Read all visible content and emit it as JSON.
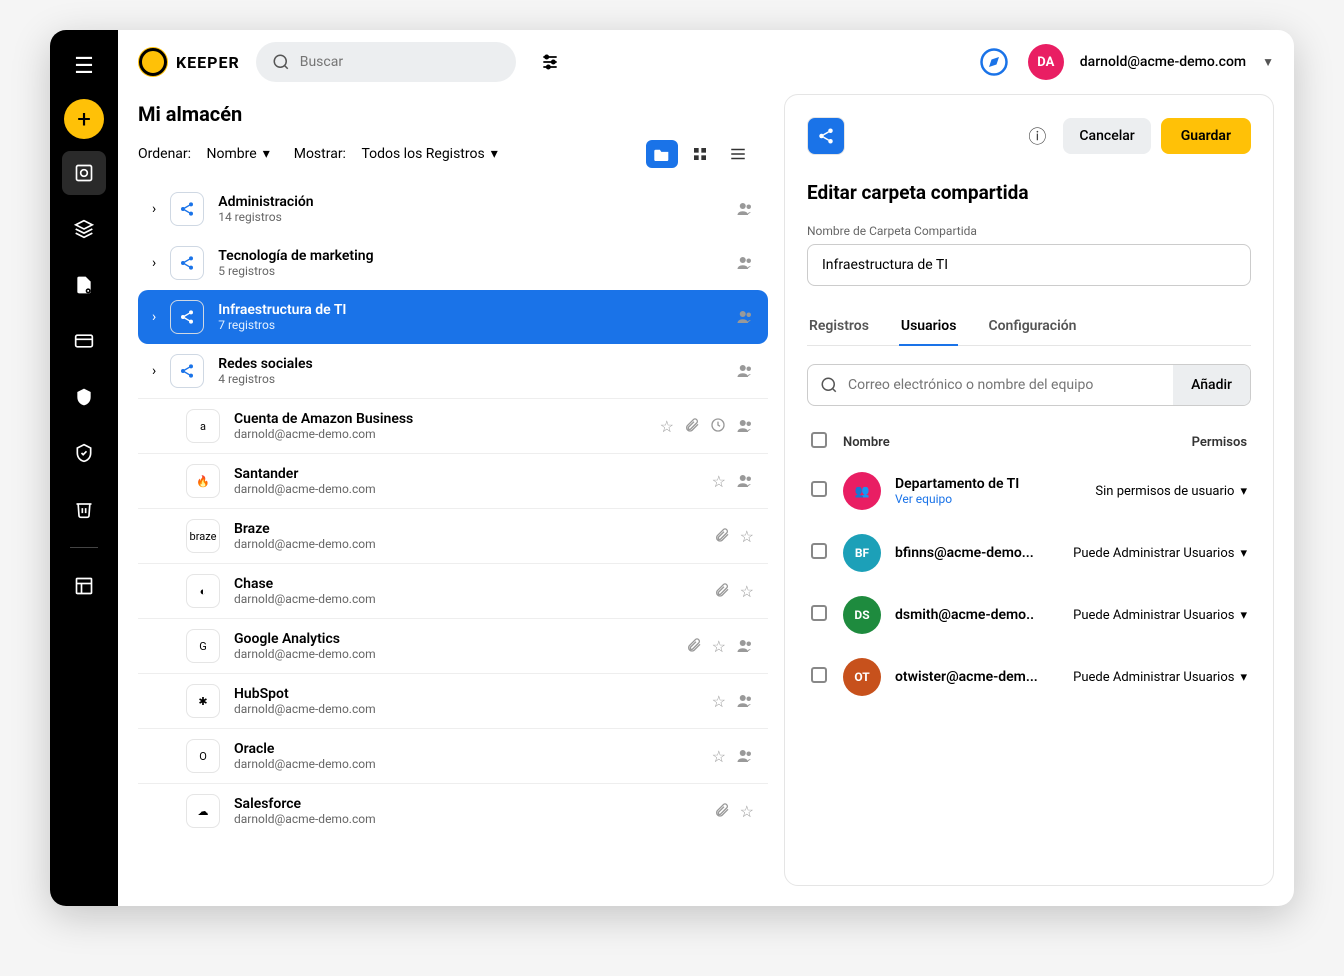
{
  "brand": "KEEPER",
  "search": {
    "placeholder": "Buscar"
  },
  "user": {
    "initials": "DA",
    "email": "darnold@acme-demo.com"
  },
  "vault": {
    "title": "Mi almacén",
    "sort_label": "Ordenar:",
    "sort_value": "Nombre",
    "show_label": "Mostrar:",
    "show_value": "Todos los Registros"
  },
  "folders": [
    {
      "name": "Administración",
      "count": "14 registros",
      "selected": false
    },
    {
      "name": "Tecnología de marketing",
      "count": "5 registros",
      "selected": false
    },
    {
      "name": "Infraestructura de TI",
      "count": "7 registros",
      "selected": true
    },
    {
      "name": "Redes sociales",
      "count": "4 registros",
      "selected": false
    }
  ],
  "records": [
    {
      "name": "Cuenta de Amazon Business",
      "sub": "darnold@acme-demo.com",
      "icon": "a",
      "actions": [
        "star",
        "clip",
        "time",
        "share"
      ]
    },
    {
      "name": "Santander",
      "sub": "darnold@acme-demo.com",
      "icon": "🔥",
      "actions": [
        "star",
        "share"
      ]
    },
    {
      "name": "Braze",
      "sub": "darnold@acme-demo.com",
      "icon": "braze",
      "actions": [
        "clip",
        "star"
      ]
    },
    {
      "name": "Chase",
      "sub": "darnold@acme-demo.com",
      "icon": "◐",
      "actions": [
        "clip",
        "star"
      ]
    },
    {
      "name": "Google Analytics",
      "sub": "darnold@acme-demo.com",
      "icon": "G",
      "actions": [
        "clip",
        "star",
        "share"
      ]
    },
    {
      "name": "HubSpot",
      "sub": "darnold@acme-demo.com",
      "icon": "✱",
      "actions": [
        "star",
        "share"
      ]
    },
    {
      "name": "Oracle",
      "sub": "darnold@acme-demo.com",
      "icon": "O",
      "actions": [
        "star",
        "share"
      ]
    },
    {
      "name": "Salesforce",
      "sub": "darnold@acme-demo.com",
      "icon": "☁",
      "actions": [
        "clip",
        "star"
      ]
    }
  ],
  "panel": {
    "cancel": "Cancelar",
    "save": "Guardar",
    "title": "Editar carpeta compartida",
    "name_label": "Nombre de Carpeta Compartida",
    "name_value": "Infraestructura de TI",
    "tabs": [
      "Registros",
      "Usuarios",
      "Configuración"
    ],
    "add_placeholder": "Correo electrónico o nombre del equipo",
    "add_button": "Añadir",
    "header_name": "Nombre",
    "header_perm": "Permisos",
    "users": [
      {
        "name": "Departamento de TI",
        "link": "Ver equipo",
        "initials": "👥",
        "color": "#e91e63",
        "perm": "Sin permisos de usuario"
      },
      {
        "name": "bfinns@acme-demo...",
        "initials": "BF",
        "color": "#1ca0b8",
        "perm": "Puede Administrar Usuarios"
      },
      {
        "name": "dsmith@acme-demo..",
        "initials": "DS",
        "color": "#1e8b3e",
        "perm": "Puede Administrar Usuarios"
      },
      {
        "name": "otwister@acme-dem...",
        "initials": "OT",
        "color": "#c7511c",
        "perm": "Puede Administrar Usuarios"
      }
    ]
  }
}
